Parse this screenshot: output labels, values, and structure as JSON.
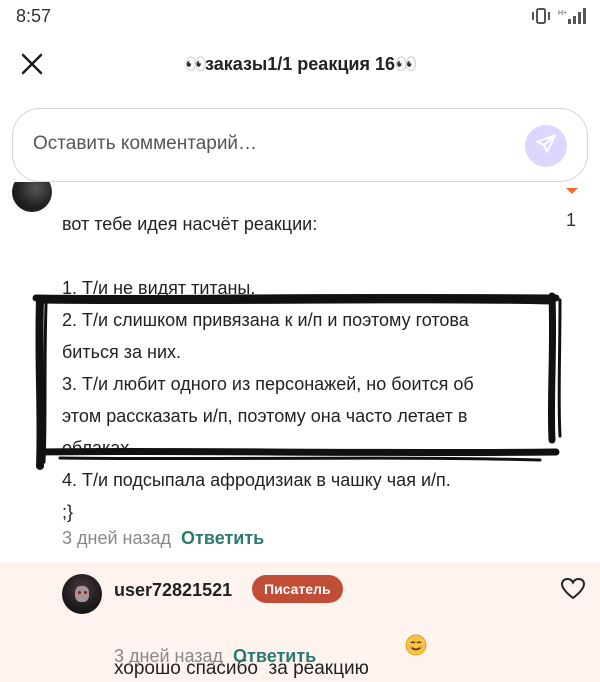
{
  "status_bar": {
    "time": "8:57",
    "icons": [
      "vibrate-icon",
      "signal-icon"
    ]
  },
  "header": {
    "close_icon": "close-icon",
    "title_prefix": "👀",
    "title_text": "заказы1/1 реакция 16",
    "title_suffix": "👀"
  },
  "comment_input": {
    "placeholder": "Оставить комментарий…",
    "send_icon": "send-icon"
  },
  "comment": {
    "likes": "1",
    "lines": [
      "вот тебе идея насчёт реакции:",
      "",
      "1. Т/и не видят титаны.",
      "2. Т/и слишком привязана к и/п и поэтому готова",
      "биться за них.",
      "3. Т/и любит одного из персонажей, но боится об",
      "этом рассказать и/п, поэтому она часто летает в",
      "облаках.",
      "4. Т/и подсыпала афродизиак в чашку чая и/п.",
      ";}"
    ],
    "time": "3 дней назад",
    "reply_label": "Ответить"
  },
  "reply": {
    "username": "user72821521",
    "badge": "Писатель",
    "text": "хорошо спасибо  за реакцию",
    "emoji_icon": "smiling-face-icon",
    "time": "3 дней назад",
    "reply_label": "Ответить",
    "heart_icon": "heart-icon"
  },
  "colors": {
    "accent_green": "#2b7a6e",
    "badge_red": "#c24d36",
    "reply_bg": "#fff3ef",
    "send_bg": "#ddd6ff",
    "like_arrow": "#ff6a2b"
  }
}
